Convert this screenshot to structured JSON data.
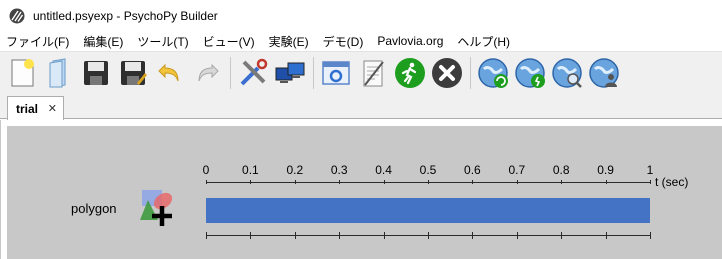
{
  "window": {
    "title": "untitled.psyexp - PsychoPy Builder"
  },
  "menu": [
    "ファイル(F)",
    "編集(E)",
    "ツール(T)",
    "ビュー(V)",
    "実験(E)",
    "デモ(D)",
    "Pavlovia.org",
    "ヘルプ(H)"
  ],
  "toolbar": {
    "buttons": [
      {
        "name": "new-file-icon"
      },
      {
        "name": "open-file-icon"
      },
      {
        "name": "save-icon"
      },
      {
        "name": "save-as-icon"
      },
      {
        "name": "undo-icon"
      },
      {
        "name": "redo-icon"
      },
      {
        "name": "preferences-icon"
      },
      {
        "name": "monitor-center-icon"
      },
      {
        "name": "experiment-settings-icon"
      },
      {
        "name": "compile-script-icon"
      },
      {
        "name": "run-icon"
      },
      {
        "name": "stop-icon"
      },
      {
        "name": "pavlovia-sync-icon"
      },
      {
        "name": "pavlovia-run-icon"
      },
      {
        "name": "pavlovia-search-icon"
      },
      {
        "name": "pavlovia-user-icon"
      }
    ]
  },
  "tabs": [
    {
      "label": "trial",
      "close": "✕"
    }
  ],
  "routine": {
    "components": [
      {
        "name": "polygon",
        "start": 0,
        "stop": 1
      }
    ],
    "timeline": {
      "ticks": [
        "0",
        "0.1",
        "0.2",
        "0.3",
        "0.4",
        "0.5",
        "0.6",
        "0.7",
        "0.8",
        "0.9",
        "1"
      ],
      "unit": "t (sec)",
      "min": 0,
      "max": 1
    }
  },
  "colors": {
    "bar": "#4472c4",
    "canvas": "#c8c8c8",
    "run_green": "#1e9e1e",
    "stop_grey": "#3c3c3c"
  }
}
